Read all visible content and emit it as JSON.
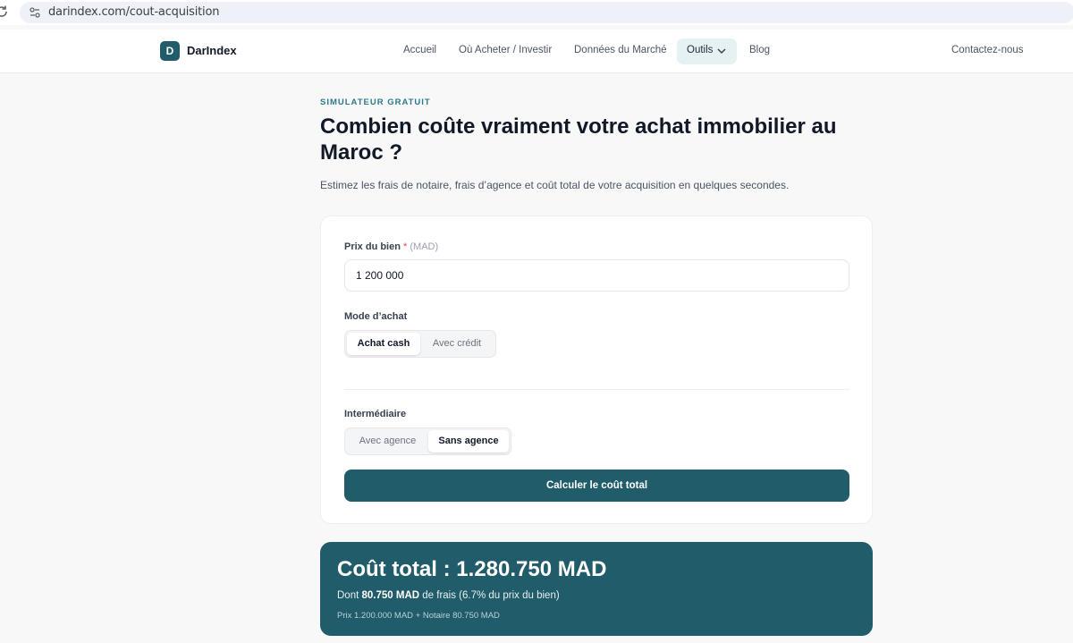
{
  "browser": {
    "url": "darindex.com/cout-acquisition"
  },
  "header": {
    "logo_letter": "D",
    "brand": "DarIndex",
    "nav": {
      "accueil": "Accueil",
      "acheter": "Où Acheter / Investir",
      "donnees": "Données du Marché",
      "outils": "Outils",
      "blog": "Blog"
    },
    "contact": "Contactez-nous"
  },
  "hero": {
    "eyebrow": "SIMULATEUR GRATUIT",
    "title": "Combien coûte vraiment votre achat immobilier au Maroc ?",
    "subtitle": "Estimez les frais de notaire, frais d’agence et coût total de votre acquisition en quelques secondes."
  },
  "form": {
    "price_label": "Prix du bien",
    "required_mark": "*",
    "price_unit": "(MAD)",
    "price_value": "1 200 000",
    "mode_label": "Mode d’achat",
    "mode_options": [
      "Achat cash",
      "Avec crédit"
    ],
    "mode_selected": "Achat cash",
    "intermediary_label": "Intermédiaire",
    "intermediary_options": [
      "Avec agence",
      "Sans agence"
    ],
    "intermediary_selected": "Sans agence",
    "submit_label": "Calculer le coût total"
  },
  "result": {
    "title": "Coût total : 1.280.750 MAD",
    "detail_prefix": "Dont",
    "fees_amount": "80.750 MAD",
    "detail_suffix": "de frais (6.7% du prix du bien)",
    "breakdown": "Prix 1.200.000 MAD + Notaire 80.750 MAD"
  },
  "colors": {
    "brand": "#215c6a",
    "eyebrow": "#2b7a8a",
    "required": "#ef4444"
  }
}
